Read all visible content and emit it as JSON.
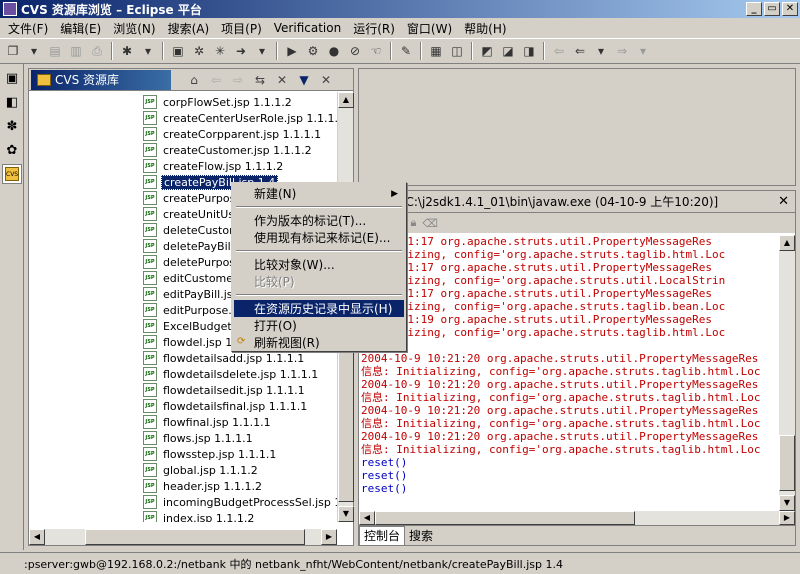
{
  "window": {
    "title": "CVS 资源库浏览 – Eclipse 平台",
    "controls": [
      "_",
      "▭",
      "✕"
    ]
  },
  "menubar": [
    "文件(F)",
    "编辑(E)",
    "浏览(N)",
    "搜索(A)",
    "项目(P)",
    "Verification",
    "运行(R)",
    "窗口(W)",
    "帮助(H)"
  ],
  "repo_view": {
    "title": "CVS 资源库",
    "files": [
      "corpFlowSet.jsp 1.1.1.2",
      "createCenterUserRole.jsp 1.1.1.2",
      "createCorpparent.jsp 1.1.1.1",
      "createCustomer.jsp 1.1.1.2",
      "createFlow.jsp 1.1.1.2",
      "createPayBill.jsp 1.4",
      "createPurpose",
      "createUnitUse",
      "deleteCustom",
      "deletePayBill.j",
      "deletePurpose",
      "editCustomer",
      "editPayBill.jsp",
      "editPurpose.js",
      "ExcelBudgetP",
      "flowdel.jsp 1.",
      "flowdetailsadd.jsp 1.1.1.1",
      "flowdetailsdelete.jsp 1.1.1.1",
      "flowdetailsedit.jsp 1.1.1.1",
      "flowdetailsfinal.jsp 1.1.1.1",
      "flowfinal.jsp 1.1.1.1",
      "flows.jsp 1.1.1.1",
      "flowsstep.jsp 1.1.1.1",
      "global.jsp 1.1.1.2",
      "header.jsp 1.1.1.2",
      "incomingBudgetProcessSel.jsp 1.1.1",
      "index.jsp 1.1.1.2"
    ],
    "selected_index": 5,
    "file_icon_text": "JSP"
  },
  "context_menu": {
    "items": [
      {
        "label": "新建(N)",
        "submenu": true
      },
      {
        "sep": true
      },
      {
        "label": "作为版本的标记(T)..."
      },
      {
        "label": "使用现有标记来标记(E)..."
      },
      {
        "sep": true
      },
      {
        "label": "比较对象(W)..."
      },
      {
        "label": "比较(P)",
        "disabled": true
      },
      {
        "sep": true
      },
      {
        "label": "在资源历史记录中显示(H)",
        "highlight": true
      },
      {
        "label": "打开(O)"
      },
      {
        "label": "刷新视图(R)",
        "icon": true
      }
    ]
  },
  "console": {
    "header": "台 [C:\\j2sdk1.4.1_01\\bin\\javaw.exe (04-10-9 上午10:20)]",
    "lines": [
      {
        "t": "-9 10:21:17 org.apache.struts.util.PropertyMessageRes",
        "c": "red"
      },
      {
        "t": "Initializing, config='org.apache.struts.taglib.html.Loc",
        "c": "red"
      },
      {
        "t": "-9 10:21:17 org.apache.struts.util.PropertyMessageRes",
        "c": "red"
      },
      {
        "t": "Initializing, config='org.apache.struts.util.LocalStrin",
        "c": "red"
      },
      {
        "t": "-9 10:21:17 org.apache.struts.util.PropertyMessageRes",
        "c": "red"
      },
      {
        "t": "Initializing, config='org.apache.struts.taglib.bean.Loc",
        "c": "red"
      },
      {
        "t": "-9 10:21:19 org.apache.struts.util.PropertyMessageRes",
        "c": "red"
      },
      {
        "t": "Initializing, config='org.apache.struts.taglib.html.Loc",
        "c": "red"
      },
      {
        "t": "",
        "c": "red"
      },
      {
        "t": "2004-10-9 10:21:20 org.apache.struts.util.PropertyMessageRes",
        "c": "red"
      },
      {
        "t": "信息: Initializing, config='org.apache.struts.taglib.html.Loc",
        "c": "red"
      },
      {
        "t": "2004-10-9 10:21:20 org.apache.struts.util.PropertyMessageRes",
        "c": "red"
      },
      {
        "t": "信息: Initializing, config='org.apache.struts.taglib.html.Loc",
        "c": "red"
      },
      {
        "t": "2004-10-9 10:21:20 org.apache.struts.util.PropertyMessageRes",
        "c": "red"
      },
      {
        "t": "信息: Initializing, config='org.apache.struts.taglib.html.Loc",
        "c": "red"
      },
      {
        "t": "2004-10-9 10:21:20 org.apache.struts.util.PropertyMessageRes",
        "c": "red"
      },
      {
        "t": "信息: Initializing, config='org.apache.struts.taglib.html.Loc",
        "c": "red"
      },
      {
        "t": "reset()",
        "c": "blue"
      },
      {
        "t": "reset()",
        "c": "blue"
      },
      {
        "t": "reset()",
        "c": "blue"
      }
    ],
    "tabs": [
      "控制台",
      "搜索"
    ]
  },
  "statusbar": {
    "text": ":pserver:gwb@192.168.0.2:/netbank 中的 netbank_nfht/WebContent/netbank/createPayBill.jsp 1.4"
  }
}
